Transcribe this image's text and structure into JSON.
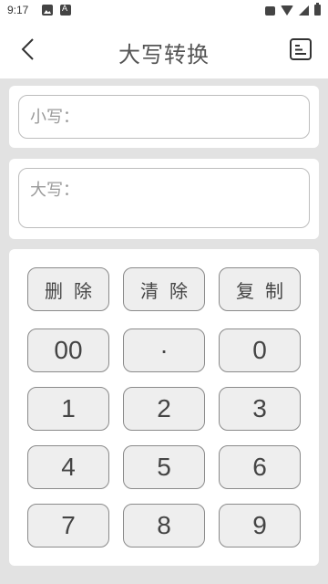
{
  "status_bar": {
    "time": "9:17"
  },
  "header": {
    "title": "大写转换"
  },
  "fields": {
    "lower_label": "小写：",
    "upper_label": "大写："
  },
  "function_keys": [
    {
      "label": "删除",
      "name": "delete-button"
    },
    {
      "label": "清除",
      "name": "clear-button"
    },
    {
      "label": "复制",
      "name": "copy-button"
    }
  ],
  "number_keys": [
    "00",
    "·",
    "0",
    "1",
    "2",
    "3",
    "4",
    "5",
    "6",
    "7",
    "8",
    "9"
  ],
  "colors": {
    "background": "#e2e2e2",
    "card": "#ffffff",
    "key_fill": "#eeeeee",
    "key_border": "#8a8a8a",
    "text": "#444444"
  }
}
